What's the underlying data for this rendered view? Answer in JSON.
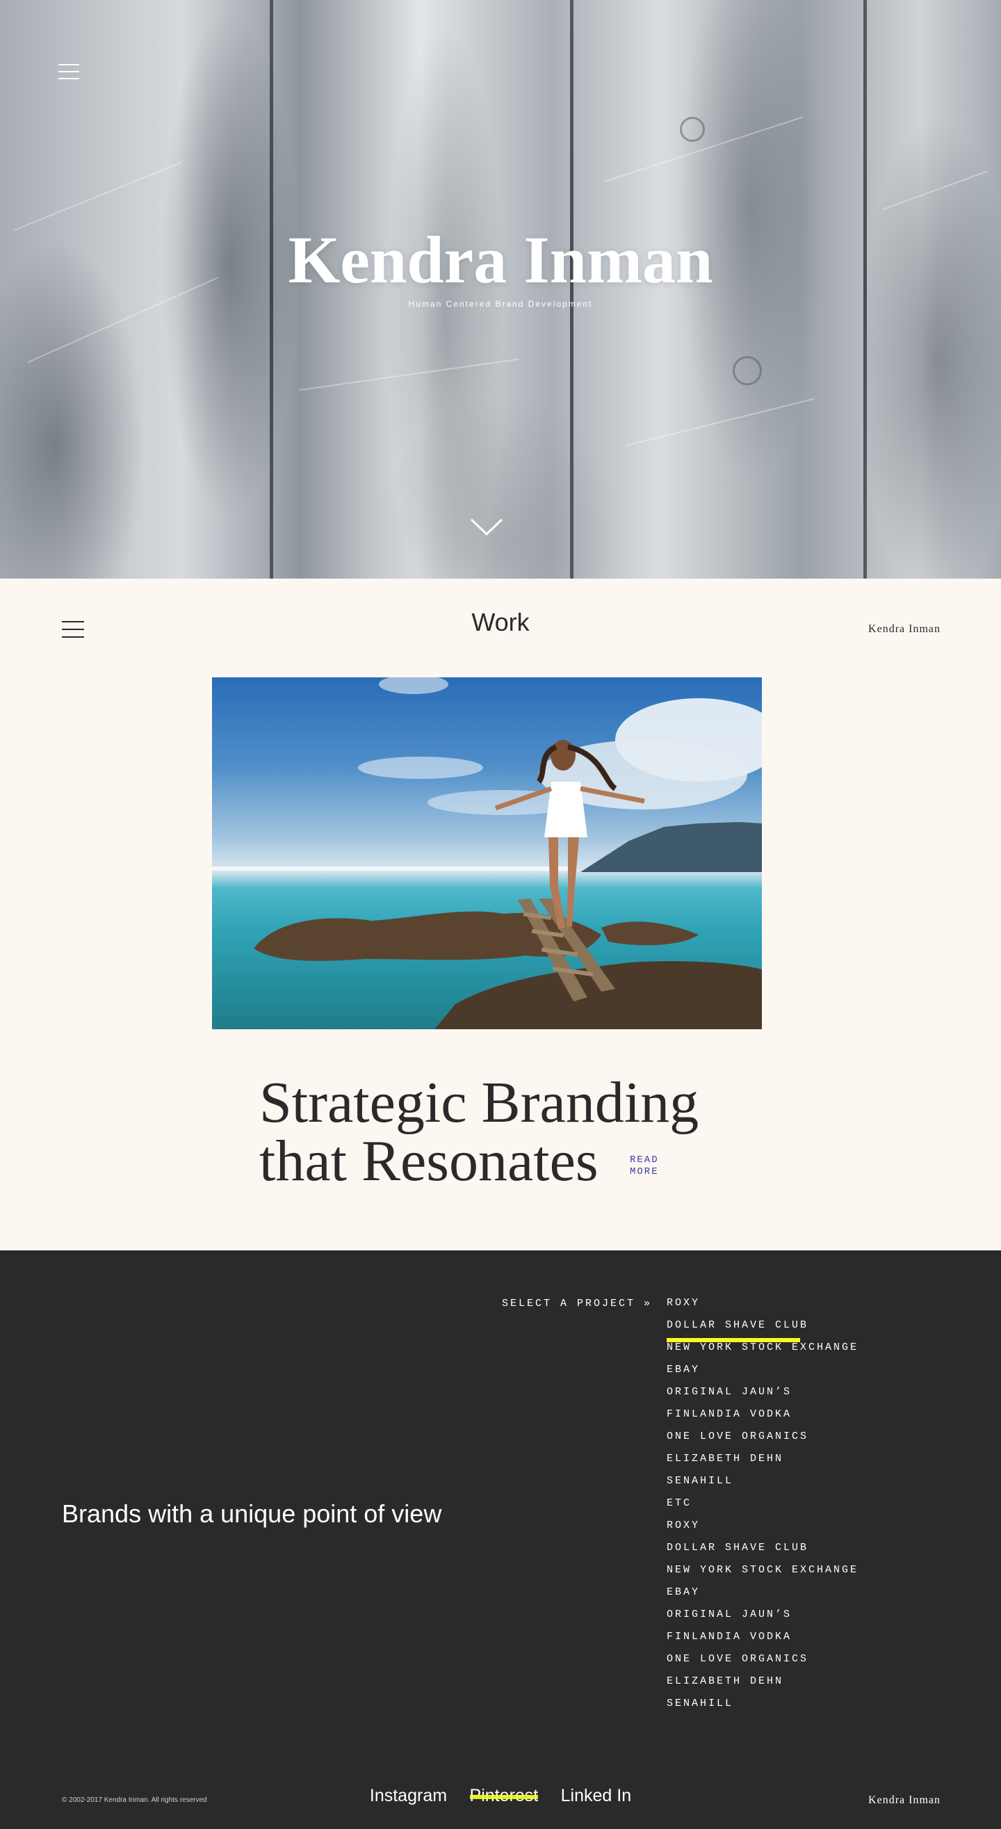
{
  "hero": {
    "title": "Kendra Inman",
    "subtitle": "Human Centered Brand Development",
    "menu_icon": "hamburger-icon",
    "scroll_icon": "chevron-down-icon"
  },
  "work": {
    "heading": "Work",
    "brand": "Kendra Inman",
    "menu_icon": "hamburger-icon",
    "headline_line1": "Strategic Branding",
    "headline_line2": "that Resonates",
    "read_more_line1": "READ",
    "read_more_line2": "MORE"
  },
  "projects": {
    "tagline": "Brands with a unique point of view",
    "select_label": "SELECT A PROJECT »",
    "items": [
      "ROXY",
      "DOLLAR SHAVE CLUB",
      "NEW YORK STOCK EXCHANGE",
      "EBAY",
      "ORIGINAL JAUN’S",
      "FINLANDIA VODKA",
      "ONE LOVE ORGANICS",
      "ELIZABETH DEHN",
      "SENAHILL",
      "ETC",
      "ROXY",
      "DOLLAR SHAVE CLUB",
      "NEW YORK STOCK EXCHANGE",
      "EBAY",
      "ORIGINAL JAUN’S",
      "FINLANDIA VODKA",
      "ONE LOVE ORGANICS",
      "ELIZABETH DEHN",
      "SENAHILL"
    ],
    "highlighted_index": 1
  },
  "footer": {
    "copyright": "© 2002-2017 Kendra Inman. All rights reserved",
    "social": [
      "Instagram",
      "Pinterest",
      "Linked In"
    ],
    "brand": "Kendra Inman"
  },
  "colors": {
    "accent_highlight": "#f6ff1f",
    "link_blue": "#3a3aa8",
    "dark_bg": "#2a2a2a",
    "cream_bg": "#fdf7f2"
  }
}
